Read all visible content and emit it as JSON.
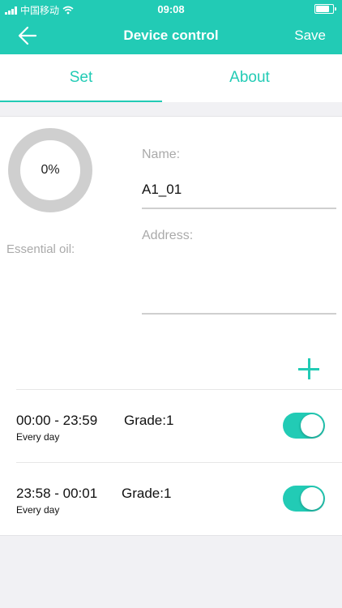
{
  "status_bar": {
    "carrier": "中国移动",
    "time": "09:08",
    "battery_level": 0.8
  },
  "header": {
    "title": "Device control",
    "save_label": "Save"
  },
  "tabs": [
    {
      "label": "Set",
      "active": true
    },
    {
      "label": "About",
      "active": false
    }
  ],
  "device": {
    "oil_percent_text": "0%",
    "oil_level": 0,
    "oil_label": "Essential oil:",
    "name_label": "Name:",
    "name_value": "A1_01",
    "address_label": "Address:",
    "address_value": ""
  },
  "schedules": [
    {
      "range": "00:00 - 23:59",
      "grade": "Grade:1",
      "repeat": "Every day",
      "enabled": true
    },
    {
      "range": "23:58 - 00:01",
      "grade": "Grade:1",
      "repeat": "Every day",
      "enabled": true
    }
  ],
  "colors": {
    "accent": "#22cbb5",
    "ring_track": "#cfcfcf",
    "muted_text": "#aaaaaa",
    "background": "#f1f1f4"
  }
}
